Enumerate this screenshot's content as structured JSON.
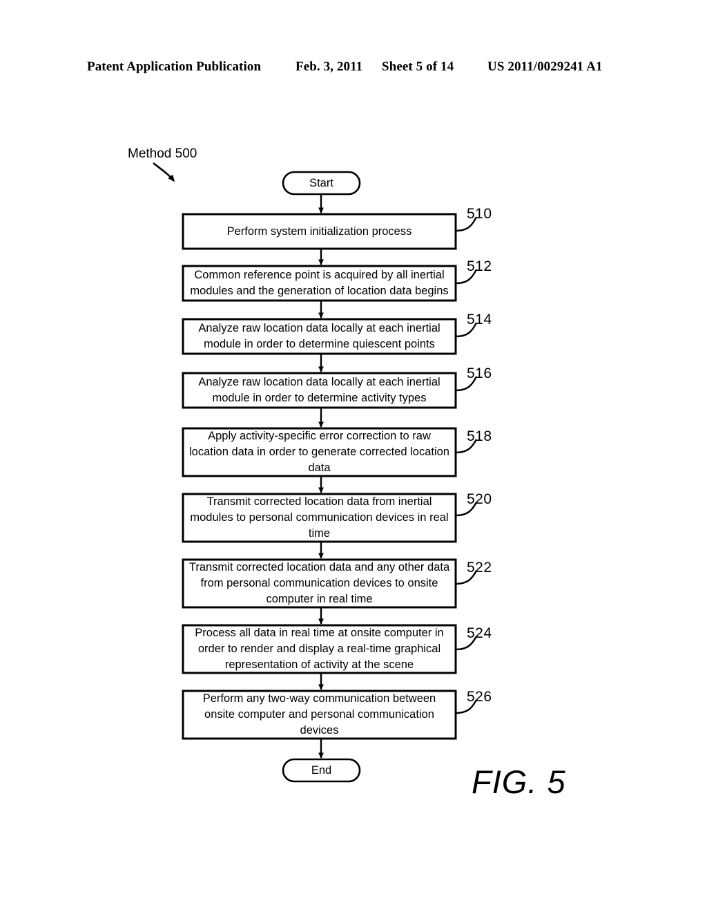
{
  "header": {
    "publication": "Patent Application Publication",
    "date": "Feb. 3, 2011",
    "sheet": "Sheet 5 of 14",
    "document_number": "US 2011/0029241 A1"
  },
  "figure": {
    "caption": "FIG. 5",
    "method_label": "Method 500",
    "start_label": "Start",
    "end_label": "End"
  },
  "chart_data": {
    "type": "diagram",
    "subtype": "flowchart",
    "title": "Method 500",
    "orientation": "top-to-bottom",
    "nodes": [
      {
        "id": "start",
        "shape": "terminator",
        "label": "Start",
        "ref": ""
      },
      {
        "id": "n510",
        "shape": "process",
        "label": "Perform system initialization process",
        "ref": "510"
      },
      {
        "id": "n512",
        "shape": "process",
        "label": "Common reference point is acquired by all inertial modules and the generation of location data begins",
        "ref": "512"
      },
      {
        "id": "n514",
        "shape": "process",
        "label": "Analyze raw location data locally at each inertial module in order to determine quiescent points",
        "ref": "514"
      },
      {
        "id": "n516",
        "shape": "process",
        "label": "Analyze raw location data locally at each inertial module in order to determine activity types",
        "ref": "516"
      },
      {
        "id": "n518",
        "shape": "process",
        "label": "Apply activity-specific error correction to raw location data in order to generate corrected location data",
        "ref": "518"
      },
      {
        "id": "n520",
        "shape": "process",
        "label": "Transmit corrected location data from inertial modules to personal communication devices in real time",
        "ref": "520"
      },
      {
        "id": "n522",
        "shape": "process",
        "label": "Transmit corrected location data and any other data from personal communication devices to onsite computer in real time",
        "ref": "522"
      },
      {
        "id": "n524",
        "shape": "process",
        "label": "Process all data in real time at onsite computer in order to render and display a real-time graphical representation of activity at the scene",
        "ref": "524"
      },
      {
        "id": "n526",
        "shape": "process",
        "label": "Perform any two-way communication between onsite computer and personal communication devices",
        "ref": "526"
      },
      {
        "id": "end",
        "shape": "terminator",
        "label": "End",
        "ref": ""
      }
    ],
    "edges": [
      {
        "from": "start",
        "to": "n510"
      },
      {
        "from": "n510",
        "to": "n512"
      },
      {
        "from": "n512",
        "to": "n514"
      },
      {
        "from": "n514",
        "to": "n516"
      },
      {
        "from": "n516",
        "to": "n518"
      },
      {
        "from": "n518",
        "to": "n520"
      },
      {
        "from": "n520",
        "to": "n522"
      },
      {
        "from": "n522",
        "to": "n524"
      },
      {
        "from": "n524",
        "to": "n526"
      },
      {
        "from": "n526",
        "to": "end"
      }
    ],
    "colors": {
      "ink": "#000000",
      "background": "#ffffff"
    }
  }
}
